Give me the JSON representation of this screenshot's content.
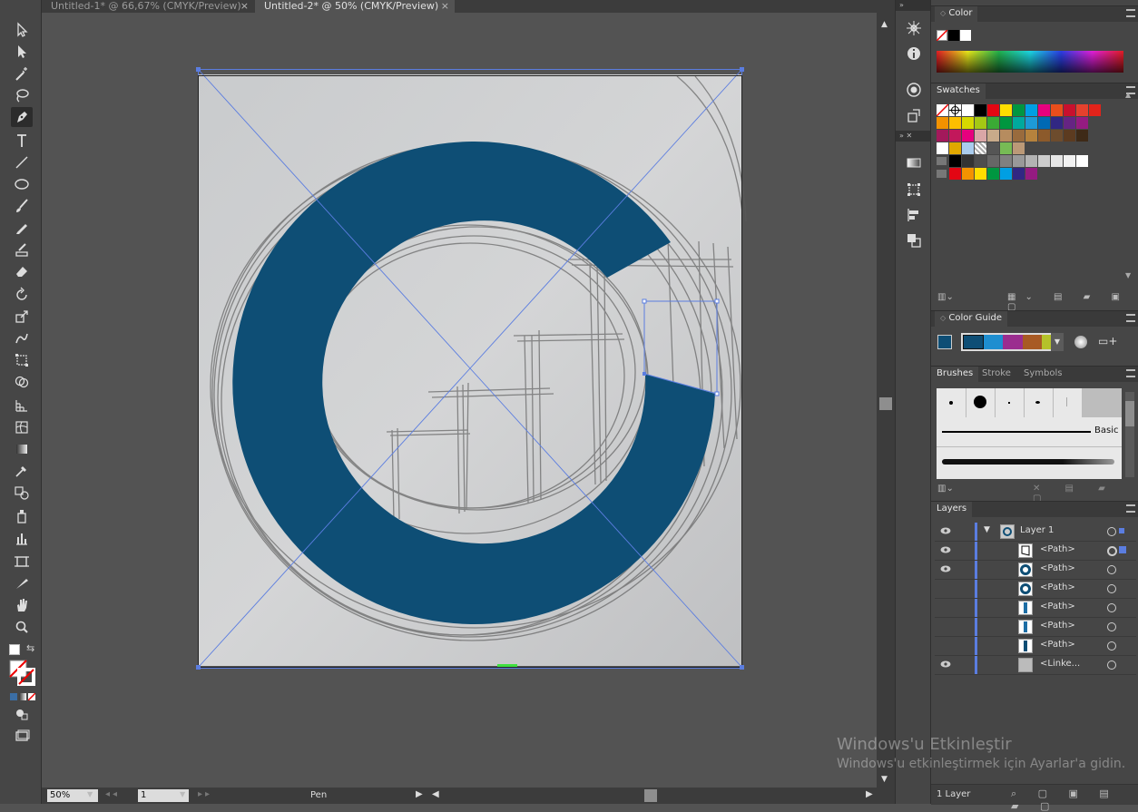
{
  "tabs": [
    {
      "title": "Untitled-1* @ 66,67% (CMYK/Preview)",
      "close": "×"
    },
    {
      "title": "Untitled-2* @ 50% (CMYK/Preview)",
      "close": "×"
    }
  ],
  "status": {
    "zoom": "50%",
    "artboard": "1",
    "tool": "Pen"
  },
  "panels": {
    "color": {
      "title": "Color"
    },
    "swatches": {
      "title": "Swatches"
    },
    "color_guide": {
      "title": "Color Guide"
    },
    "brushes": {
      "tabs": [
        "Brushes",
        "Stroke",
        "Symbols"
      ],
      "basic_label": "Basic"
    },
    "layers": {
      "title": "Layers",
      "rows": [
        {
          "name": "Layer 1"
        },
        {
          "name": "<Path>"
        },
        {
          "name": "<Path>"
        },
        {
          "name": "<Path>"
        },
        {
          "name": "<Path>"
        },
        {
          "name": "<Path>"
        },
        {
          "name": "<Path>"
        },
        {
          "name": "<Linke..."
        }
      ],
      "count": "1 Layer"
    }
  },
  "colors": {
    "artwork_blue": "#0e4e75",
    "ui_bg": "#535353",
    "panel_bg": "#464646",
    "selection": "#5b7de0"
  },
  "watermark": {
    "line1": "Windows'u Etkinleştir",
    "line2": "Windows'u etkinleştirmek için Ayarlar'a gidin."
  }
}
